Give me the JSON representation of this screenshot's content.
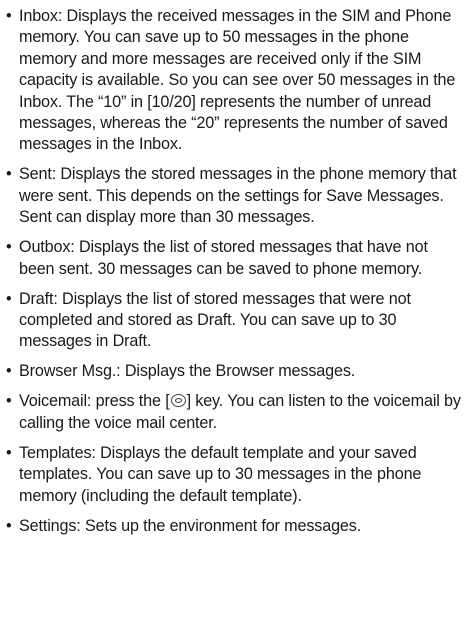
{
  "items": [
    "Inbox: Displays the received messages in the SIM and Phone memory. You can save up to 50 messages in the phone memory and more messages are received only if the SIM capacity is available. So you can see over 50 messages in the Inbox. The “10” in [10/20] represents the number of unread messages, whereas the “20” represents the number of saved messages in the Inbox.",
    "Sent: Displays the stored messages in the phone memory that were sent. This depends on the settings for Save Messages. Sent can display more than 30 messages.",
    "Outbox: Displays the list of stored messages that have not been sent. 30 messages can be saved to phone memory.",
    "Draft: Displays the list of stored messages that were not completed and stored as Draft. You can save up to 30 messages in Draft.",
    "Browser Msg.: Displays the Browser messages.",
    {
      "before_icon": "Voicemail: press the [",
      "icon": "ok-key-icon",
      "after_icon": "] key. You can listen to the voicemail by calling the voice mail center."
    },
    "Templates: Displays the default template and your saved templates. You can save up to 30 messages in the phone memory (including the default template).",
    "Settings: Sets up the environment for messages."
  ]
}
